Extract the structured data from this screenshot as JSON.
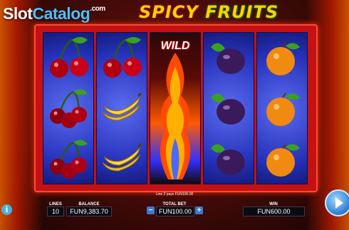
{
  "watermark": {
    "part1": "Slot",
    "part2": "Catalog",
    "suffix": ".com"
  },
  "logo": {
    "word1": "SPICY",
    "word2": "FRUITS"
  },
  "reels": [
    {
      "symbols": [
        "cherry-icon",
        "cherry-icon",
        "cherry-icon"
      ]
    },
    {
      "symbols": [
        "cherry-icon",
        "banana-icon",
        "banana-icon"
      ]
    },
    {
      "symbols": [
        "wild-fire-icon"
      ],
      "label": "WILD"
    },
    {
      "symbols": [
        "plum-icon",
        "plum-icon",
        "plum-icon"
      ]
    },
    {
      "symbols": [
        "orange-icon",
        "orange-icon",
        "orange-icon"
      ]
    }
  ],
  "status": {
    "line_win": "Line 2 pays FUN100.00"
  },
  "controls": {
    "lines_label": "LINES",
    "lines_value": "10",
    "balance_label": "BALANCE",
    "balance_value": "FUN9,383.70",
    "total_bet_label": "TOTAL BET",
    "total_bet_value": "FUN100.00",
    "minus": "−",
    "plus": "+",
    "win_label": "WIN",
    "win_value": "FUN600.00",
    "info": "i"
  },
  "colors": {
    "frame": "#c41212",
    "reel_bg": "#2530b8",
    "accent": "#ffd200"
  }
}
